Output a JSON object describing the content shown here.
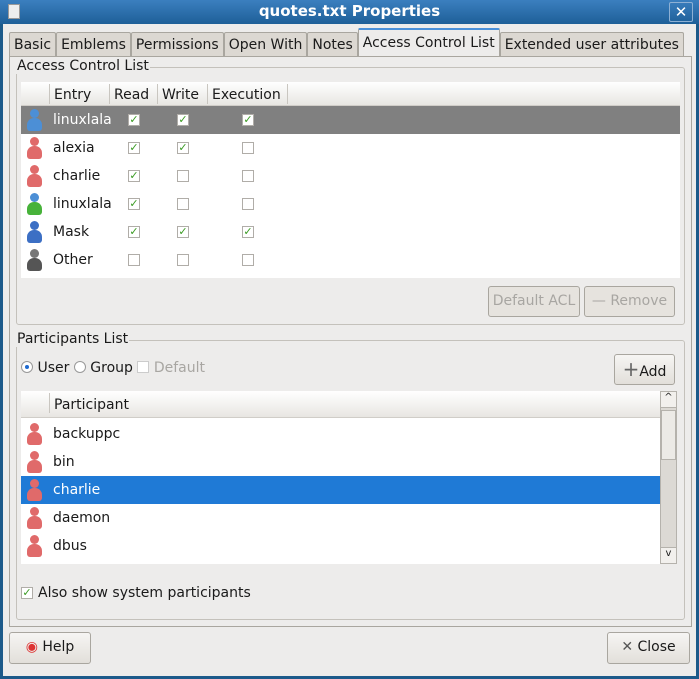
{
  "window": {
    "title": "quotes.txt Properties",
    "close": "✕"
  },
  "tabs": [
    {
      "label": "Basic"
    },
    {
      "label": "Emblems"
    },
    {
      "label": "Permissions"
    },
    {
      "label": "Open With"
    },
    {
      "label": "Notes"
    },
    {
      "label": "Access Control List",
      "active": true
    },
    {
      "label": "Extended user attributes"
    }
  ],
  "acl": {
    "title": "Access Control List",
    "columns": [
      "Entry",
      "Read",
      "Write",
      "Execution"
    ],
    "rows": [
      {
        "entry": "linuxlala",
        "icon": "user-blue-icon",
        "read": true,
        "write": true,
        "exec": true,
        "selected": true
      },
      {
        "entry": "alexia",
        "icon": "user-red-icon",
        "read": true,
        "write": true,
        "exec": false
      },
      {
        "entry": "charlie",
        "icon": "user-red-icon",
        "read": true,
        "write": false,
        "exec": false
      },
      {
        "entry": "linuxlala",
        "icon": "group-icon",
        "read": true,
        "write": false,
        "exec": false
      },
      {
        "entry": "Mask",
        "icon": "mask-icon",
        "read": true,
        "write": true,
        "exec": true
      },
      {
        "entry": "Other",
        "icon": "other-icon",
        "read": false,
        "write": false,
        "exec": false
      }
    ],
    "default_acl": "Default ACL",
    "remove": "Remove"
  },
  "participants": {
    "title": "Participants List",
    "user": "User",
    "group": "Group",
    "default": "Default",
    "add": "Add",
    "column": "Participant",
    "rows": [
      {
        "name": "backuppc"
      },
      {
        "name": "bin"
      },
      {
        "name": "charlie",
        "selected": true
      },
      {
        "name": "daemon"
      },
      {
        "name": "dbus"
      }
    ],
    "show_system": "Also show system participants",
    "show_system_checked": true
  },
  "footer": {
    "help": "Help",
    "close": "Close"
  },
  "colors": {
    "selection": "#1f7ad6",
    "border": "#1c5a8a"
  }
}
